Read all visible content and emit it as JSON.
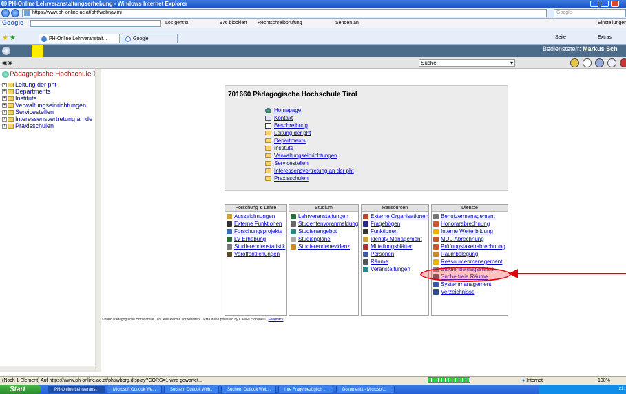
{
  "window": {
    "title": "PH-Online Lehrveranstaltungserhebung - Windows Internet Explorer"
  },
  "address": {
    "url": "https://www.ph-online.ac.at/pht/webnav.ini",
    "search_placeholder": "Google"
  },
  "google_toolbar": {
    "logo": "Google",
    "go_label": "Los geht's!",
    "blocked": "976 blockiert",
    "spell": "Rechtschreibprüfung",
    "send": "Senden an",
    "settings": "Einstellungen"
  },
  "tabs": [
    {
      "label": "PH-Online Lehrveranstalt..."
    },
    {
      "label": "Google"
    }
  ],
  "ie_commands": {
    "page": "Seite",
    "extras": "Extras"
  },
  "header": {
    "user_label": "Bedienstete/r:",
    "user_name": "Markus Sch",
    "search_select": "Suche"
  },
  "tree": {
    "root": "Pädagogische Hochschule Ti",
    "items": [
      "Leitung der pht",
      "Departments",
      "Institute",
      "Verwaltungseinrichtungen",
      "Servicestellen",
      "Interessensvertretung an de",
      "Praxisschulen"
    ]
  },
  "org": {
    "title": "701660 Pädagogische Hochschule Tirol",
    "links": [
      "Homepage",
      "Kontakt",
      "Beschreibung",
      "Leitung der pht",
      "Departments",
      "Institute",
      "Verwaltungseinrichtungen",
      "Servicestellen",
      "Interessensvertretung an der pht",
      "Praxisschulen"
    ]
  },
  "panels": [
    {
      "title": "Forschung & Lehre",
      "items": [
        "Auszeichnungen",
        "Externe Funktionen",
        "Forschungsprojekte",
        "LV Erhebung",
        "Studierendenstatistik",
        "Veröffentlichungen"
      ]
    },
    {
      "title": "Studium",
      "items": [
        "Lehrveranstaltungen",
        "Studentenvoranmeldung",
        "Studienangebot",
        "Studienpläne",
        "Studierendenevidenz"
      ]
    },
    {
      "title": "Ressourcen",
      "items": [
        "Externe Organisationen",
        "Fragebögen",
        "Funktionen",
        "Identity Management",
        "Mitteilungsblätter",
        "Personen",
        "Räume",
        "Veranstaltungen"
      ]
    },
    {
      "title": "Dienste",
      "items": [
        "Benutzermanagement",
        "Honorarabrechnung",
        "Interne Weiterbildung",
        "MDL-Abrechnung",
        "Prüfungstaxenabrechnung",
        "Raumbelegung",
        "Ressourcenmanagement",
        "Studienbeitragsstatus",
        "Suche freie Räume",
        "Systemmanagement",
        "Verzeichnisse"
      ]
    }
  ],
  "footer": {
    "text": "©2008 Pädagogische Hochschule Tirol. Alle Rechte vorbehalten. | PH-Online powered by CAMPUSonline® | ",
    "feedback": "Feedback"
  },
  "status": {
    "text": "(Noch 1 Element) Auf https://www.ph-online.ac.at/pht/wborg.display?CORG=1 wird gewartet...",
    "zone": "Internet",
    "zoom": "100%"
  },
  "taskbar": {
    "start": "Start",
    "tasks": [
      "PH-Online Lehrverans...",
      "Microsoft Outlook We...",
      "Suchen: Outlook Web...",
      "Suchen: Outlook Web...",
      "Ihre Frage bezüglich ...",
      "Dokument1 - Microsof..."
    ],
    "clock": "21:"
  }
}
